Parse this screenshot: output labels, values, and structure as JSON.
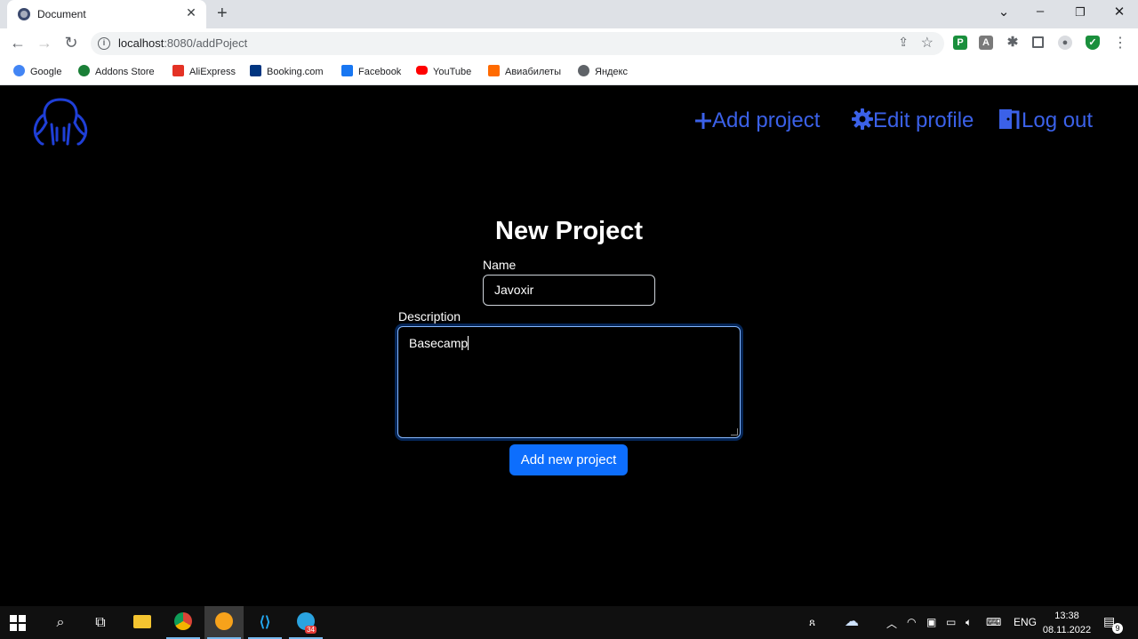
{
  "browser": {
    "tab_title": "Document",
    "tab_close": "✕",
    "new_tab": "+",
    "url_host": "localhost",
    "url_rest": ":8080/addPoject",
    "bookmarks": [
      {
        "label": "Google",
        "color": "#4285f4"
      },
      {
        "label": "Addons Store",
        "color": "#1a7f37"
      },
      {
        "label": "AliExpress",
        "color": "#e43225"
      },
      {
        "label": "Booking.com",
        "color": "#003580"
      },
      {
        "label": "Facebook",
        "color": "#1877f2"
      },
      {
        "label": "YouTube",
        "color": "#ff0000"
      },
      {
        "label": "Авиабилеты",
        "color": "#ff6a00"
      },
      {
        "label": "Яндекс",
        "color": "#5f6368"
      }
    ]
  },
  "nav": {
    "add_project": "Add project",
    "edit_profile": "Edit profile",
    "log_out": "Log out",
    "link_color": "#3b61e8"
  },
  "form": {
    "title": "New Project",
    "name_label": "Name",
    "name_value": "Javoxir",
    "description_label": "Description",
    "description_value": "Basecamp",
    "submit_label": "Add new project",
    "button_color": "#0d6efd"
  },
  "taskbar": {
    "language": "ENG",
    "time": "13:38",
    "date": "08.11.2022",
    "notification_count": "9",
    "telegram_badge": "34"
  }
}
